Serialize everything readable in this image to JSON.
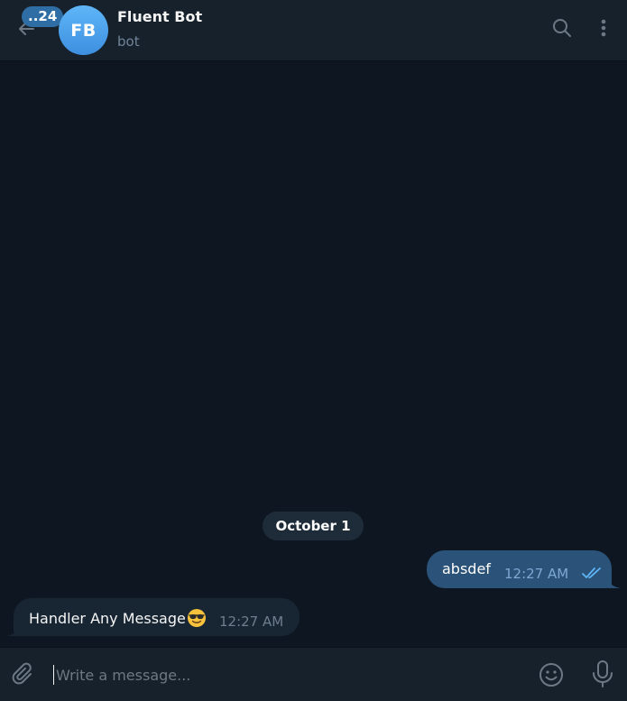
{
  "header": {
    "unread_count": "..24",
    "avatar_initials": "FB",
    "title": "Fluent Bot",
    "subtitle": "bot",
    "icons": {
      "back": "arrow-left-icon",
      "search": "search-icon",
      "menu": "more-vertical-icon"
    }
  },
  "messages": {
    "date_separator": "October 1",
    "outgoing": {
      "text": "absdef",
      "time": "12:27 AM",
      "status_icon": "double-check-icon"
    },
    "incoming": {
      "text": "Handler Any Message",
      "emoji_icon": "sunglasses-face-emoji",
      "time": "12:27 AM"
    }
  },
  "composer": {
    "placeholder": "Write a message...",
    "value": "",
    "icons": {
      "attach": "paperclip-icon",
      "emoji": "smiley-icon",
      "voice": "microphone-icon"
    }
  },
  "colors": {
    "background": "#0e1621",
    "panel": "#17212b",
    "accent": "#2f6ea5",
    "outgoing_bubble": "#2b5278",
    "incoming_bubble": "#182533",
    "read_check": "#5eb5f7"
  }
}
